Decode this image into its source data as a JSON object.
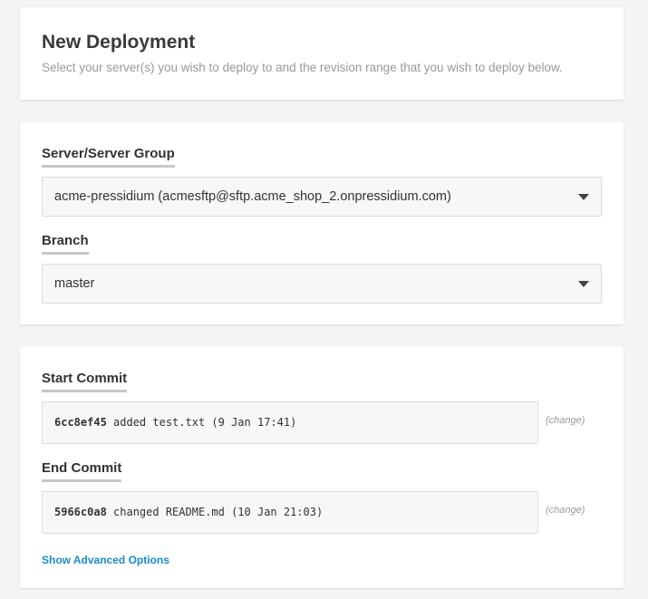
{
  "header": {
    "title": "New Deployment",
    "subtitle": "Select your server(s) you wish to deploy to and the revision range that you wish to deploy below."
  },
  "server": {
    "label": "Server/Server Group",
    "selected": "acme-pressidium (acmesftp@sftp.acme_shop_2.onpressidium.com)"
  },
  "branch": {
    "label": "Branch",
    "selected": "master"
  },
  "start_commit": {
    "label": "Start Commit",
    "sha": "6cc8ef45",
    "message": " added test.txt (9 Jan 17:41)",
    "change_label": "(change)"
  },
  "end_commit": {
    "label": "End Commit",
    "sha": "5966c0a8",
    "message": " changed README.md (10 Jan 21:03)",
    "change_label": "(change)"
  },
  "advanced": {
    "label": "Show Advanced Options"
  },
  "colors": {
    "link": "#1a8ac6",
    "background": "#f4f4f4",
    "card": "#ffffff",
    "field_bg": "#f7f7f7"
  },
  "icons": {
    "dropdown": "caret-down-icon"
  }
}
